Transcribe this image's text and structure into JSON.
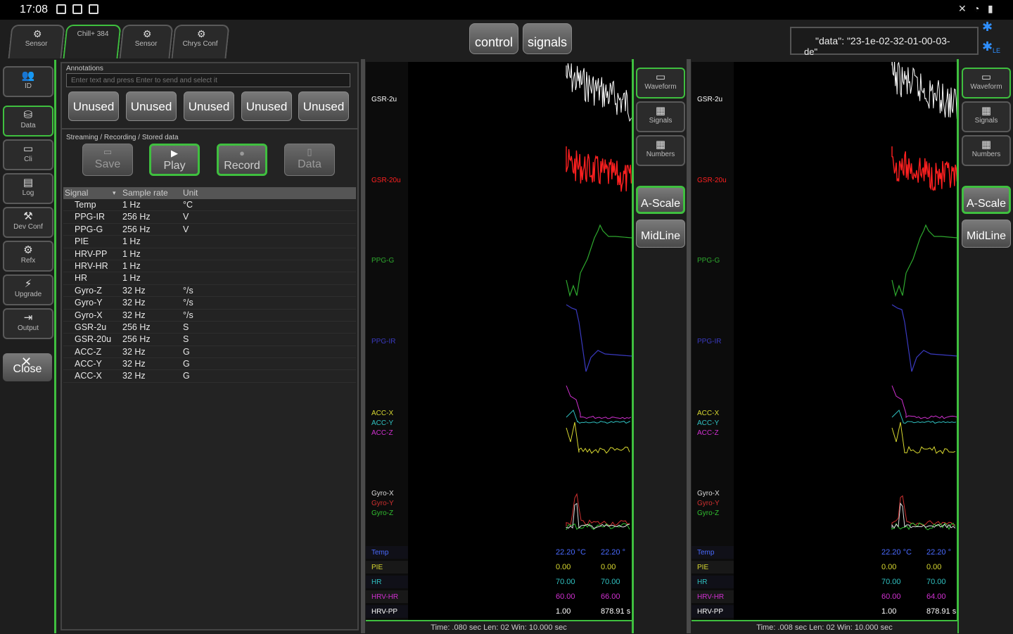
{
  "status_bar": {
    "time": "17:08"
  },
  "top_tabs": [
    {
      "label": "Sensor",
      "icon": "gear-icon"
    },
    {
      "label": "Chill+ 384",
      "icon": "sensor-icon"
    },
    {
      "label": "Sensor",
      "icon": "gear-icon"
    },
    {
      "label": "Chrys Conf",
      "icon": "gear-icon"
    }
  ],
  "center_buttons": {
    "control": "control",
    "signals": "signals"
  },
  "data_file": "\"data\": \"23-1e-02-32-01-00-03-",
  "data_file_tail": "de\"",
  "bluetooth_label": "LE",
  "sidebar": [
    {
      "label": "ID",
      "icon": "users-icon"
    },
    {
      "label": "Data",
      "icon": "database-icon"
    },
    {
      "label": "Cli",
      "icon": "terminal-icon"
    },
    {
      "label": "Log",
      "icon": "log-icon"
    },
    {
      "label": "Dev Conf",
      "icon": "tools-icon"
    },
    {
      "label": "Refx",
      "icon": "refx-icon"
    },
    {
      "label": "Upgrade",
      "icon": "upgrade-icon"
    },
    {
      "label": "Output",
      "icon": "output-icon"
    }
  ],
  "close_label": "Close",
  "annotations": {
    "label": "Annotations",
    "placeholder": "Enter text and press Enter to send and select it",
    "buttons": [
      "Unused",
      "Unused",
      "Unused",
      "Unused",
      "Unused"
    ]
  },
  "streaming": {
    "label": "Streaming / Recording / Stored data",
    "buttons": [
      "Save",
      "Play",
      "Record",
      "Data"
    ]
  },
  "signal_table": {
    "headers": [
      "Signal",
      "Sample rate",
      "Unit"
    ],
    "rows": [
      [
        "Temp",
        "1 Hz",
        "°C"
      ],
      [
        "PPG-IR",
        "256 Hz",
        "V"
      ],
      [
        "PPG-G",
        "256 Hz",
        "V"
      ],
      [
        "PIE",
        "1 Hz",
        ""
      ],
      [
        "HRV-PP",
        "1 Hz",
        ""
      ],
      [
        "HRV-HR",
        "1 Hz",
        ""
      ],
      [
        "HR",
        "1 Hz",
        ""
      ],
      [
        "Gyro-Z",
        "32 Hz",
        "°/s"
      ],
      [
        "Gyro-Y",
        "32 Hz",
        "°/s"
      ],
      [
        "Gyro-X",
        "32 Hz",
        "°/s"
      ],
      [
        "GSR-2u",
        "256 Hz",
        "S"
      ],
      [
        "GSR-20u",
        "256 Hz",
        "S"
      ],
      [
        "ACC-Z",
        "32 Hz",
        "G"
      ],
      [
        "ACC-Y",
        "32 Hz",
        "G"
      ],
      [
        "ACC-X",
        "32 Hz",
        "G"
      ]
    ]
  },
  "plots": [
    {
      "channels": [
        "GSR-2u",
        "GSR-20u",
        "PPG-G",
        "PPG-IR"
      ],
      "acc": [
        "ACC-X",
        "ACC-Y",
        "ACC-Z"
      ],
      "gyro": [
        "Gyro-X",
        "Gyro-Y",
        "Gyro-Z"
      ],
      "numbers": [
        {
          "label": "Temp",
          "v1": "22.20 °C",
          "v2": "22.20 °"
        },
        {
          "label": "PIE",
          "v1": "0.00",
          "v2": "0.00"
        },
        {
          "label": "HR",
          "v1": "70.00",
          "v2": "70.00"
        },
        {
          "label": "HRV-HR",
          "v1": "60.00",
          "v2": "66.00"
        },
        {
          "label": "HRV-PP",
          "v1": "1.00",
          "v2": "878.91 s"
        }
      ],
      "footer": "Time: .080 sec   Len: 02   Win: 10.000 sec"
    },
    {
      "channels": [
        "GSR-2u",
        "GSR-20u",
        "PPG-G",
        "PPG-IR"
      ],
      "acc": [
        "ACC-X",
        "ACC-Y",
        "ACC-Z"
      ],
      "gyro": [
        "Gyro-X",
        "Gyro-Y",
        "Gyro-Z"
      ],
      "numbers": [
        {
          "label": "Temp",
          "v1": "22.20 °C",
          "v2": "22.20 °"
        },
        {
          "label": "PIE",
          "v1": "0.00",
          "v2": "0.00"
        },
        {
          "label": "HR",
          "v1": "70.00",
          "v2": "70.00"
        },
        {
          "label": "HRV-HR",
          "v1": "60.00",
          "v2": "64.00"
        },
        {
          "label": "HRV-PP",
          "v1": "1.00",
          "v2": "878.91 s"
        }
      ],
      "footer": "Time: .008 sec   Len: 02   Win: 10.000 sec"
    }
  ],
  "right_tabs": [
    "Waveform",
    "Signals",
    "Numbers"
  ],
  "right_buttons": [
    "A-Scale",
    "MidLine"
  ],
  "colors": {
    "accent_green": "#3fbf3f",
    "gsr2": "#ffffff",
    "gsr20": "#ff2020",
    "ppg_g": "#2ea82e",
    "ppg_ir": "#3a3ac0",
    "acc_x": "#d8d830",
    "acc_y": "#30c0c0",
    "acc_z": "#d030d0",
    "gyro_x": "#dddddd",
    "gyro_y": "#d03030",
    "gyro_z": "#30c030"
  }
}
